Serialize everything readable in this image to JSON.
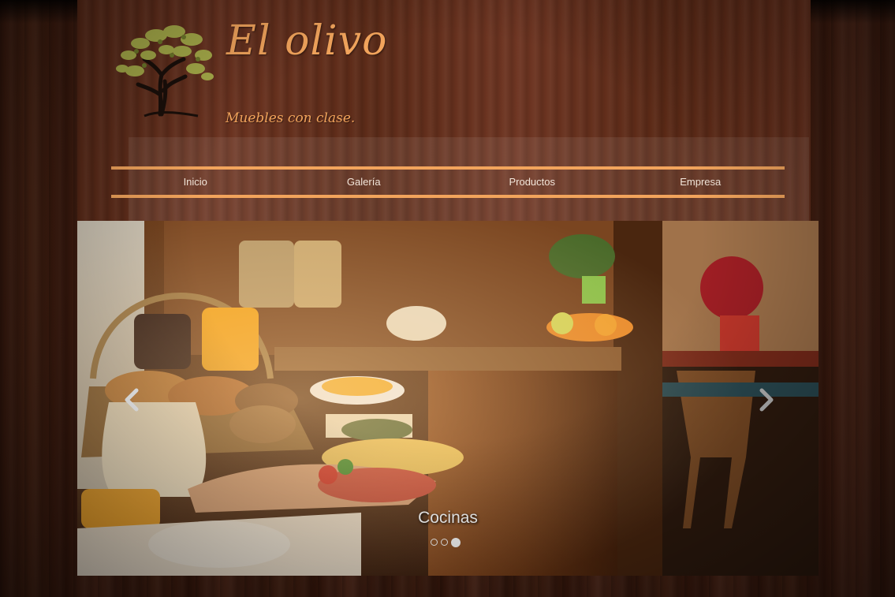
{
  "brand": {
    "title": "El olivo",
    "tagline": "Muebles con clase."
  },
  "nav": {
    "items": [
      {
        "label": "Inicio"
      },
      {
        "label": "Galería"
      },
      {
        "label": "Productos"
      },
      {
        "label": "Empresa"
      }
    ]
  },
  "slider": {
    "caption": "Cocinas",
    "slide_count": 3,
    "active_slide": 3,
    "prev_icon": "chevron-left-icon",
    "next_icon": "chevron-right-icon"
  },
  "colors": {
    "accent": "#f2a45c",
    "nav_text": "#f3e6da",
    "caption_text": "#ffffff"
  }
}
